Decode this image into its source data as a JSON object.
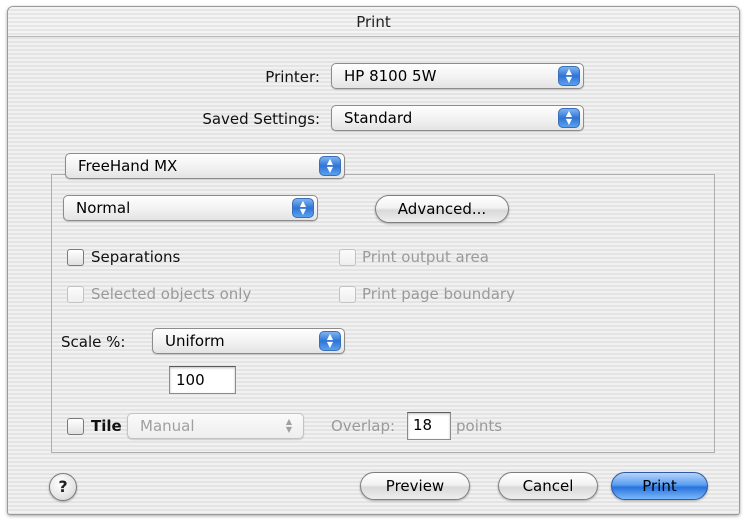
{
  "window": {
    "title": "Print"
  },
  "printer": {
    "label": "Printer:",
    "value": "HP 8100 5W"
  },
  "saved_settings": {
    "label": "Saved Settings:",
    "value": "Standard"
  },
  "panel": {
    "value": "FreeHand MX"
  },
  "mode": {
    "value": "Normal"
  },
  "buttons": {
    "advanced": "Advanced...",
    "preview": "Preview",
    "cancel": "Cancel",
    "print": "Print",
    "help": "?"
  },
  "options": {
    "separations": {
      "label": "Separations",
      "checked": false,
      "enabled": true
    },
    "selected_objects_only": {
      "label": "Selected objects only",
      "checked": false,
      "enabled": false
    },
    "print_output_area": {
      "label": "Print output area",
      "checked": false,
      "enabled": false
    },
    "print_page_boundary": {
      "label": "Print page boundary",
      "checked": false,
      "enabled": false
    }
  },
  "scale": {
    "label": "Scale %:",
    "mode": "Uniform",
    "value": "100"
  },
  "tile": {
    "label": "Tile",
    "mode": "Manual",
    "overlap_label": "Overlap:",
    "overlap_value": "18",
    "overlap_unit": "points"
  },
  "colors": {
    "accent": "#2a73de",
    "disabled_text": "#9a9a9a"
  }
}
